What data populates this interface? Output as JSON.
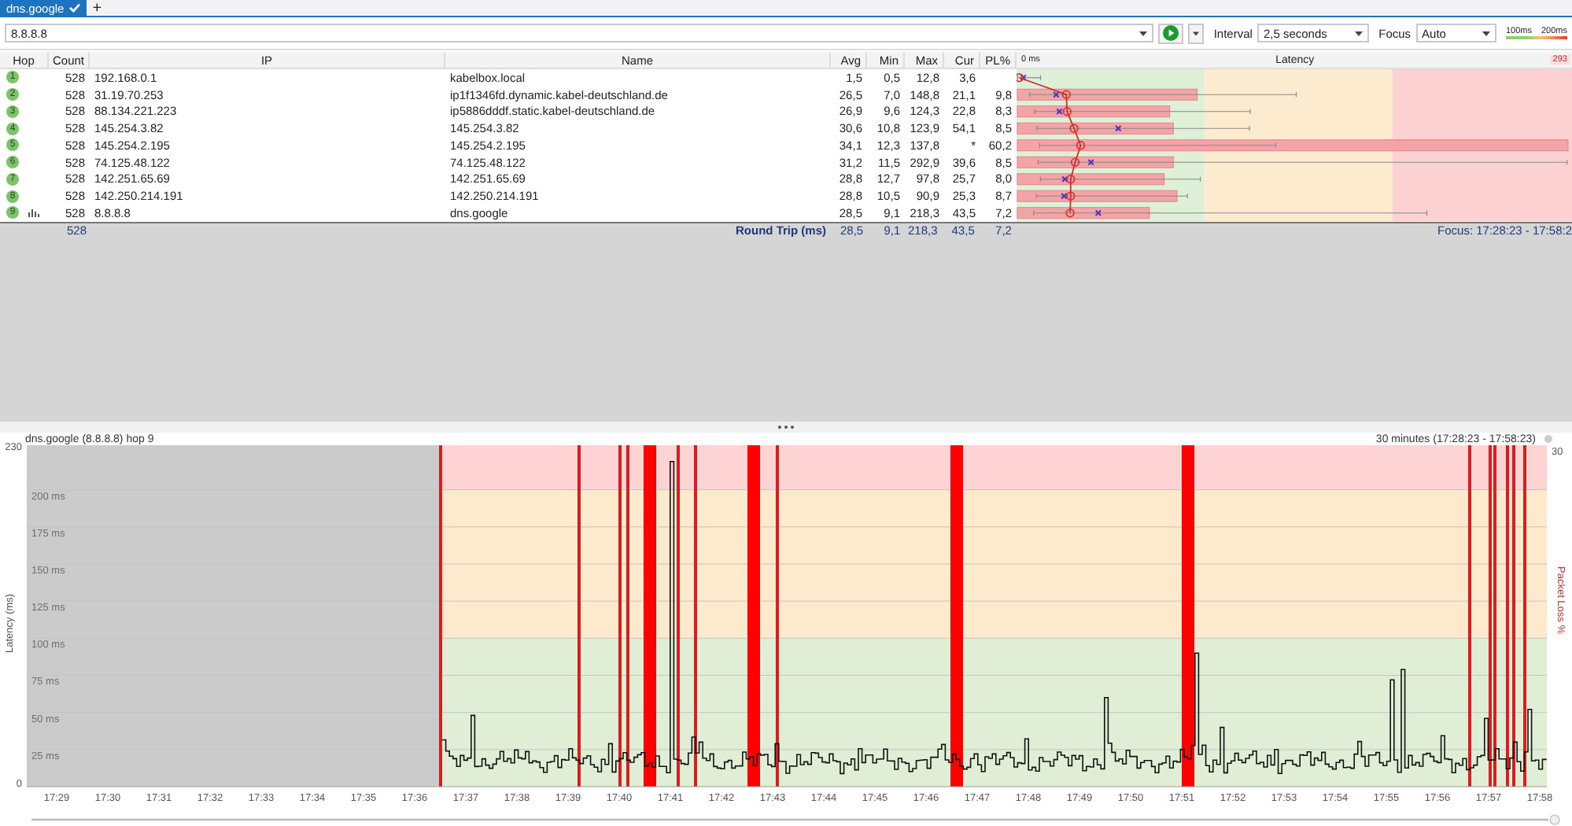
{
  "tabs": [
    {
      "label": "dns.google",
      "selected": true
    }
  ],
  "new_tab_button": "+",
  "toolbar": {
    "target": "8.8.8.8",
    "interval_label": "Interval",
    "interval": "2,5 seconds",
    "focus_label": "Focus",
    "focus": "Auto",
    "legend": [
      "100ms",
      "200ms"
    ]
  },
  "table": {
    "columns": [
      "Hop",
      "Count",
      "IP",
      "Name",
      "Avg",
      "Min",
      "Max",
      "Cur",
      "PL%"
    ],
    "latency_header": {
      "start": "0 ms",
      "title": "Latency",
      "end": "293"
    },
    "rows": [
      {
        "hop": "1",
        "count": "528",
        "ip": "192.168.0.1",
        "name": "kabelbox.local",
        "avg": "1,5",
        "min": "0,5",
        "max": "12,8",
        "cur": "3,6",
        "pl": "",
        "graphed": false
      },
      {
        "hop": "2",
        "count": "528",
        "ip": "31.19.70.253",
        "name": "ip1f1346fd.dynamic.kabel-deutschland.de",
        "avg": "26,5",
        "min": "7,0",
        "max": "148,8",
        "cur": "21,1",
        "pl": "9,8",
        "graphed": false
      },
      {
        "hop": "3",
        "count": "528",
        "ip": "88.134.221.223",
        "name": "ip5886dddf.static.kabel-deutschland.de",
        "avg": "26,9",
        "min": "9,6",
        "max": "124,3",
        "cur": "22,8",
        "pl": "8,3",
        "graphed": false
      },
      {
        "hop": "4",
        "count": "528",
        "ip": "145.254.3.82",
        "name": "145.254.3.82",
        "avg": "30,6",
        "min": "10,8",
        "max": "123,9",
        "cur": "54,1",
        "pl": "8,5",
        "graphed": false
      },
      {
        "hop": "5",
        "count": "528",
        "ip": "145.254.2.195",
        "name": "145.254.2.195",
        "avg": "34,1",
        "min": "12,3",
        "max": "137,8",
        "cur": "*",
        "pl": "60,2",
        "graphed": false
      },
      {
        "hop": "6",
        "count": "528",
        "ip": "74.125.48.122",
        "name": "74.125.48.122",
        "avg": "31,2",
        "min": "11,5",
        "max": "292,9",
        "cur": "39,6",
        "pl": "8,5",
        "graphed": false
      },
      {
        "hop": "7",
        "count": "528",
        "ip": "142.251.65.69",
        "name": "142.251.65.69",
        "avg": "28,8",
        "min": "12,7",
        "max": "97,8",
        "cur": "25,7",
        "pl": "8,0",
        "graphed": false
      },
      {
        "hop": "8",
        "count": "528",
        "ip": "142.250.214.191",
        "name": "142.250.214.191",
        "avg": "28,8",
        "min": "10,5",
        "max": "90,9",
        "cur": "25,3",
        "pl": "8,7",
        "graphed": false
      },
      {
        "hop": "9",
        "count": "528",
        "ip": "8.8.8.8",
        "name": "dns.google",
        "avg": "28,5",
        "min": "9,1",
        "max": "218,3",
        "cur": "43,5",
        "pl": "7,2",
        "graphed": true
      }
    ],
    "summary": {
      "count": "528",
      "label": "Round Trip (ms)",
      "avg": "28,5",
      "min": "9,1",
      "max": "218,3",
      "cur": "43,5",
      "pl": "7,2",
      "focus": "Focus: 17:28:23 - 17:58:2"
    }
  },
  "graph": {
    "title": "dns.google (8.8.8.8) hop 9",
    "range": "30 minutes (17:28:23 - 17:58:23)",
    "y_max": "230",
    "y_min": "0",
    "y_gridlines": [
      "200 ms",
      "175 ms",
      "150 ms",
      "125 ms",
      "100 ms",
      "75 ms",
      "50 ms",
      "25 ms"
    ],
    "y_title": "Latency (ms)",
    "right_title": "Packet Loss %",
    "right_max": "30",
    "x_ticks": [
      "17:29",
      "17:30",
      "17:31",
      "17:32",
      "17:33",
      "17:34",
      "17:35",
      "17:36",
      "17:37",
      "17:38",
      "17:39",
      "17:40",
      "17:41",
      "17:42",
      "17:43",
      "17:44",
      "17:45",
      "17:46",
      "17:47",
      "17:48",
      "17:49",
      "17:50",
      "17:51",
      "17:52",
      "17:53",
      "17:54",
      "17:55",
      "17:56",
      "17:57",
      "17:58"
    ]
  }
}
